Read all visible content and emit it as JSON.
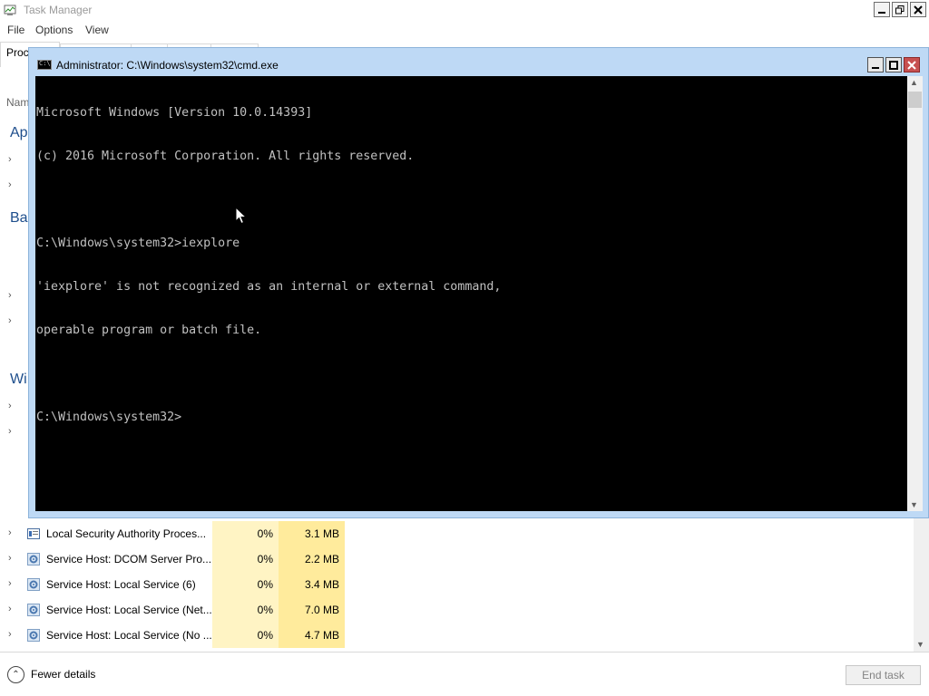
{
  "task_manager": {
    "title": "Task Manager",
    "menu": [
      "File",
      "Options",
      "View"
    ],
    "visible_tab_fragment": "Proc",
    "column_fragment": "Nam",
    "section_fragments": [
      "Ap",
      "Bac",
      "Wi"
    ],
    "processes": [
      {
        "name": "Local Security Authority Proces...",
        "cpu": "0%",
        "memory": "3.1 MB",
        "icon": "shield-app-icon"
      },
      {
        "name": "Service Host: DCOM Server Pro...",
        "cpu": "0%",
        "memory": "2.2 MB",
        "icon": "gear-icon"
      },
      {
        "name": "Service Host: Local Service (6)",
        "cpu": "0%",
        "memory": "3.4 MB",
        "icon": "gear-icon"
      },
      {
        "name": "Service Host: Local Service (Net...",
        "cpu": "0%",
        "memory": "7.0 MB",
        "icon": "gear-icon"
      },
      {
        "name": "Service Host: Local Service (No ...",
        "cpu": "0%",
        "memory": "4.7 MB",
        "icon": "gear-icon"
      }
    ],
    "footer": {
      "fewer_details": "Fewer details",
      "end_task": "End task"
    }
  },
  "cmd_window": {
    "title": "Administrator: C:\\Windows\\system32\\cmd.exe",
    "lines": [
      "Microsoft Windows [Version 10.0.14393]",
      "(c) 2016 Microsoft Corporation. All rights reserved.",
      "",
      "C:\\Windows\\system32>iexplore",
      "'iexplore' is not recognized as an internal or external command,",
      "operable program or batch file.",
      "",
      "C:\\Windows\\system32>"
    ]
  }
}
